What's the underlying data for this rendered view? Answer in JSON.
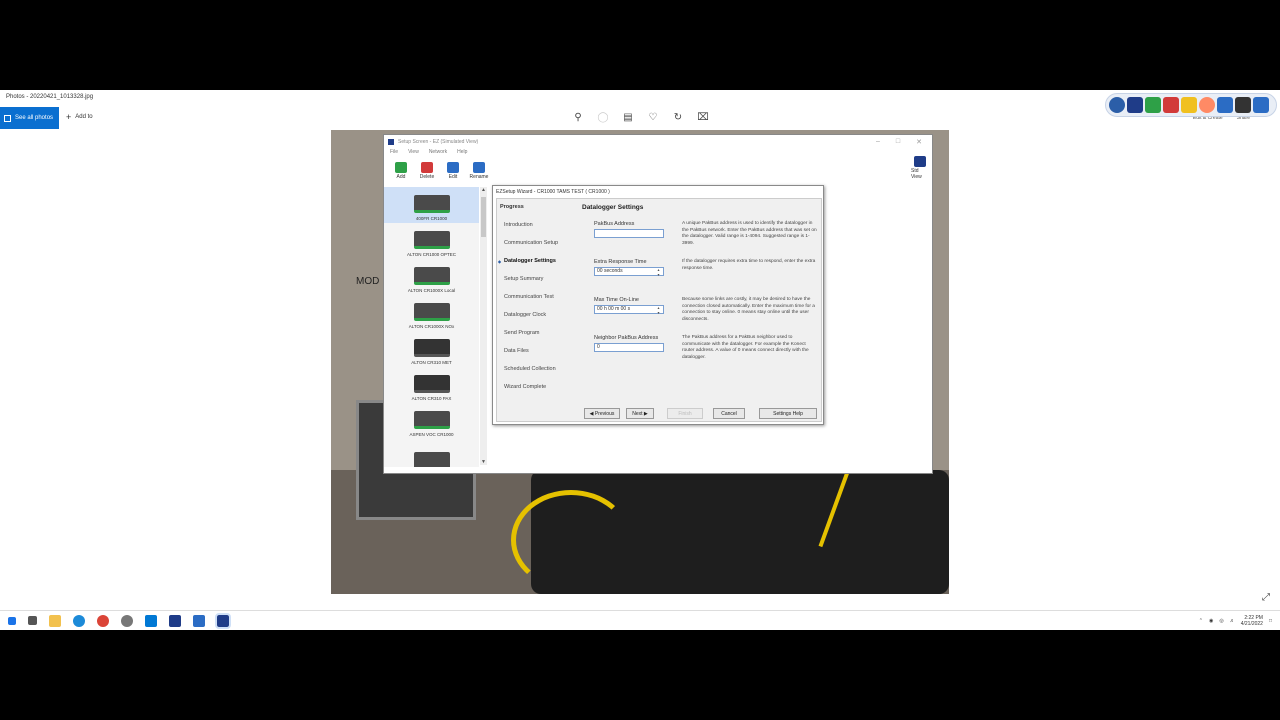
{
  "photos_app": {
    "title": "Photos - 20220421_1013328.jpg",
    "see_all": "See all photos",
    "add_to": "Add to",
    "edit_create": "Edit & Create",
    "share": "Share"
  },
  "logger_window": {
    "title": "Setup Screen - EZ (Simulated View)",
    "menu": [
      "File",
      "View",
      "Network",
      "Help"
    ],
    "toolbar": [
      {
        "label": "Add",
        "color": "#2ea047"
      },
      {
        "label": "Delete",
        "color": "#d23a3a"
      },
      {
        "label": "Edit",
        "color": "#2b6cc4"
      },
      {
        "label": "Rename",
        "color": "#2b6cc4"
      }
    ],
    "std_view": "Std View",
    "devices": [
      "400FR CR1000",
      "ALTON CR1000 OPTEC",
      "ALTON CR1000X Local",
      "ALTON CR1000X NOx",
      "ALTON CR310 MET",
      "ALTON CR310 PAX",
      "ASPEN VOC CR1000",
      ""
    ]
  },
  "wizard": {
    "title": "EZSetup Wizard - CR1000 TAMS TEST ( CR1000 )",
    "progress_heading": "Progress",
    "steps": [
      "Introduction",
      "Communication Setup",
      "Datalogger Settings",
      "Setup Summary",
      "Communication Test",
      "Datalogger Clock",
      "Send Program",
      "Data Files",
      "Scheduled Collection",
      "Wizard Complete"
    ],
    "current_step": "Datalogger Settings",
    "section_heading": "Datalogger Settings",
    "pakbus_label": "PakBus Address",
    "pakbus_value": "",
    "pakbus_help": "A unique PakBus address is used to identify the datalogger in the PakBus network. Enter the PakBus address that was set on the datalogger. Valid range is 1-4094. Suggested range is 1-3999.",
    "extra_label": "Extra Response Time",
    "extra_value": "00 seconds",
    "extra_help": "If the datalogger requires extra time to respond, enter the extra response time.",
    "maxtime_label": "Max Time On-Line",
    "maxtime_value": "00 h 00 m 00 s",
    "maxtime_help": "Because some links are costly, it may be desired to have the connection closed automatically. Enter the maximum time for a connection to stay online. 0 means stay online until the user disconnects.",
    "neighbor_label": "Neighbor PakBus Address",
    "neighbor_value": "0",
    "neighbor_help": "The PakBus address for a PakBus neighbor used to communicate with the datalogger. For example the Konect router address. A value of 0 means connect directly with the datalogger.",
    "buttons": {
      "previous": "Previous",
      "next": "Next",
      "finish": "Finish",
      "cancel": "Cancel",
      "help": "Settings Help"
    }
  },
  "photo_text": "MOD",
  "taskbar": {
    "time": "2:22 PM",
    "date": "4/21/2022"
  }
}
